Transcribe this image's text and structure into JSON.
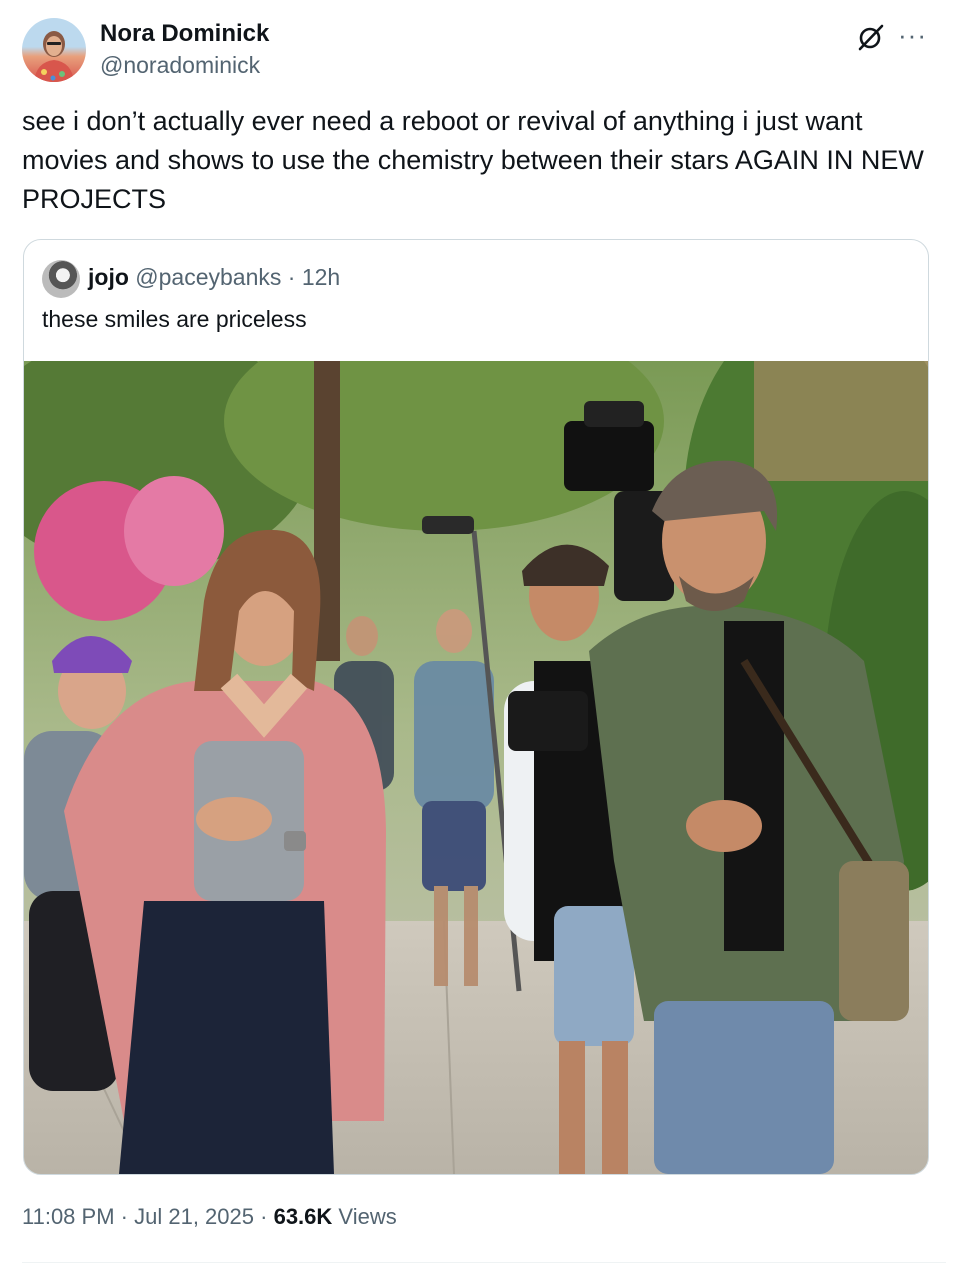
{
  "author": {
    "name": "Nora Dominick",
    "handle": "@noradominick"
  },
  "post": {
    "text": "see i don’t actually ever need a reboot or revival of anything i just want movies and shows to use the chemistry between their stars AGAIN IN NEW PROJECTS",
    "time": "11:08 PM",
    "date": "Jul 21, 2025",
    "views_count": "63.6K",
    "views_label": "Views"
  },
  "quoted": {
    "name": "jojo",
    "handle": "@paceybanks",
    "age": "12h",
    "text": "these smiles are priceless"
  },
  "icons": {
    "grok": "grok-icon",
    "more": "more-icon"
  },
  "colors": {
    "text_primary": "#0f1419",
    "text_secondary": "#536471",
    "border": "#cfd9de"
  }
}
